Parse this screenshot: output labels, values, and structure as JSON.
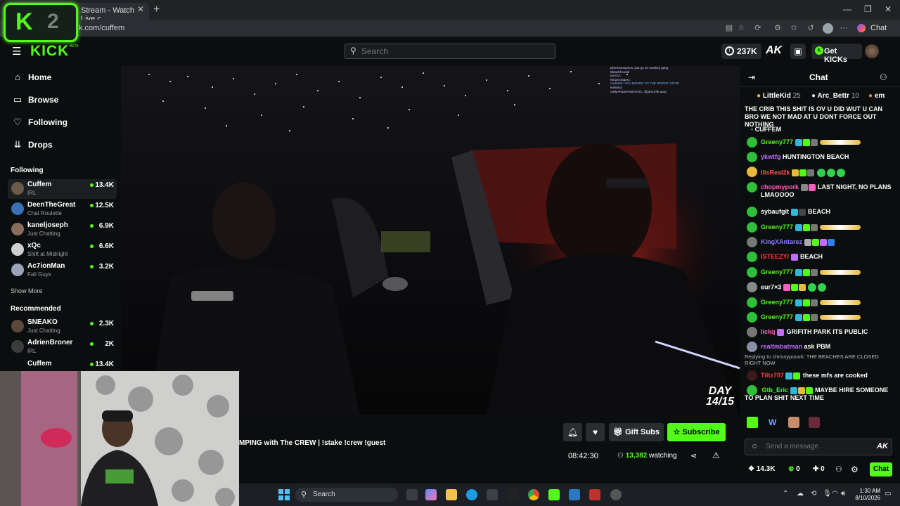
{
  "browser": {
    "tab_title": "Stream - Watch Live c",
    "url": "k.com/cuffem",
    "copilot_label": "Chat"
  },
  "overlay_logo": {
    "k": "K",
    "num": "2"
  },
  "header": {
    "logo": "KICK",
    "beta": "BETA",
    "search_placeholder": "Search",
    "kicks_balance": "237K",
    "ak_logo": "AK",
    "get_kicks": "Get KICKs"
  },
  "sidebar": {
    "nav": [
      {
        "label": "Home",
        "icon": "home-icon"
      },
      {
        "label": "Browse",
        "icon": "browse-icon"
      },
      {
        "label": "Following",
        "icon": "heart-icon"
      },
      {
        "label": "Drops",
        "icon": "drops-icon"
      }
    ],
    "following_title": "Following",
    "following": [
      {
        "name": "Cuffem",
        "category": "IRL",
        "viewers": "13.4K"
      },
      {
        "name": "DeenTheGreat",
        "category": "Chat Roulette",
        "viewers": "12.5K"
      },
      {
        "name": "kaneljoseph",
        "category": "Just Chatting",
        "viewers": "6.9K"
      },
      {
        "name": "xQc",
        "category": "Shift at Midnight",
        "viewers": "6.6K"
      },
      {
        "name": "Ac7ionMan",
        "category": "Fall Guys",
        "viewers": "3.2K"
      }
    ],
    "show_more": "Show More",
    "recommended_title": "Recommended",
    "recommended": [
      {
        "name": "SNEAKO",
        "category": "Just Chatting",
        "viewers": "2.3K"
      },
      {
        "name": "AdrienBroner",
        "category": "IRL",
        "viewers": "2K"
      },
      {
        "name": "Cuffem",
        "category": "",
        "viewers": "13.4K"
      }
    ]
  },
  "video": {
    "day_label": "DAY",
    "day_value": "14/15",
    "mini_chat": [
      "pkeemonnamos: just go on monkey gang",
      "Bleachhoodd: ",
      "eur7x3: ",
      "KingXAntarez: ",
      "Cwest69: YOU MOVED TO THE WORST STATE",
      "Kelimbo: ",
      "OSMANDZAFEROVIC: @john1Tik aura"
    ]
  },
  "stream_info": {
    "title": "MPING with The CREW | !stake !crew !guest",
    "gift_subs": "Gift Subs",
    "subscribe": "Subscribe",
    "uptime": "08:42:30",
    "watching_count": "13,382",
    "watching_label": "watching"
  },
  "chat": {
    "title": "Chat",
    "gifters": [
      {
        "name": "LittleKid",
        "count": "25"
      },
      {
        "name": "Arc_Bettr",
        "count": "10"
      },
      {
        "name": "em",
        "count": ""
      }
    ],
    "pinned_text": "THE CRIB THIS SHIT IS OV U DID WUT U CAN BRO WE NOT MAD AT U DONT FORCE OUT NOTHING",
    "pinned_user": "CUFFEM",
    "messages": [
      {
        "user": "Greeny777",
        "color": "#53fc18",
        "text": ""
      },
      {
        "user": "ykwtfg",
        "color": "#c06cff",
        "text": "HUNTINGTON BEACH"
      },
      {
        "user": "IlisReal2k",
        "color": "#ff4d4d",
        "text": ""
      },
      {
        "user": "chopmypork",
        "color": "#ff5fbd",
        "text": "LAST NIGHT, NO PLANS LMAOOOO"
      },
      {
        "user": "sybaufgit",
        "color": "#ffffff",
        "text": "BEACH"
      },
      {
        "user": "Greeny777",
        "color": "#53fc18",
        "text": ""
      },
      {
        "user": "KingXAntarez",
        "color": "#8a7bff",
        "text": ""
      },
      {
        "user": "ISTEEZYI",
        "color": "#ff3b3b",
        "text": "BEACH"
      },
      {
        "user": "Greeny777",
        "color": "#53fc18",
        "text": ""
      },
      {
        "user": "eur7×3",
        "color": "#ffffff",
        "text": ""
      },
      {
        "user": "Greeny777",
        "color": "#53fc18",
        "text": ""
      },
      {
        "user": "Greeny777",
        "color": "#53fc18",
        "text": ""
      },
      {
        "user": "lickq",
        "color": "#ff5fbd",
        "text": "GRIFITH PARK ITS PUBLIC"
      },
      {
        "user": "realtmbatman",
        "color": "#c06cff",
        "text": "ask PBM"
      }
    ],
    "reply_note": "Replying to chrissypoooh: THE BEACHES ARE CLOSED RIGHT NOW",
    "messages2": [
      {
        "user": "Tiltz707",
        "color": "#ff3b3b",
        "text": "these mfs are cooked"
      },
      {
        "user": "Gtb_Eric",
        "color": "#53fc18",
        "text": "MAYBE HIRE SOMEONE TO PLAN SHIT NEXT TIME"
      }
    ],
    "send_placeholder": "Send a message",
    "send_ak": "AK",
    "stat_kicks": "14.3K",
    "stat_a": "0",
    "stat_b": "0",
    "chat_button": "Chat"
  },
  "taskbar": {
    "search": "Search",
    "time": "1:30 AM",
    "date": "8/10/2026"
  }
}
